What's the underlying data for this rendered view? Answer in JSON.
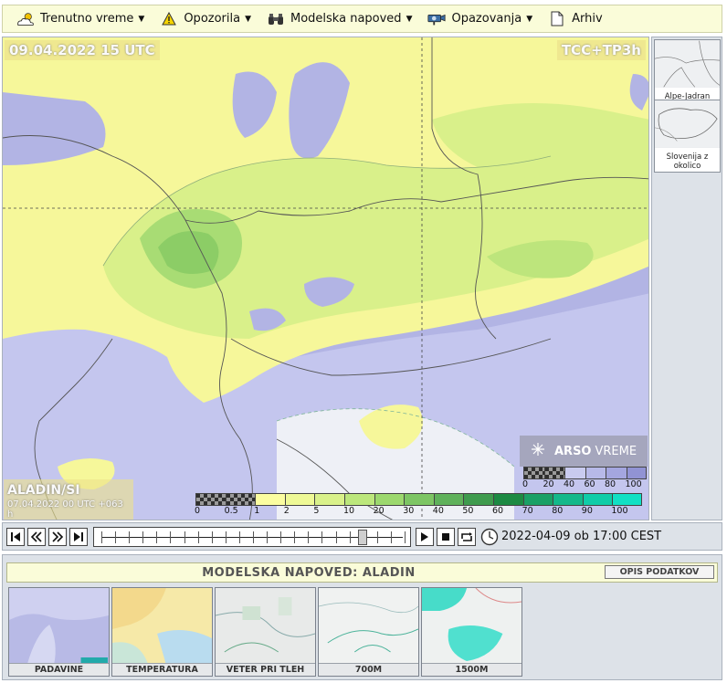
{
  "nav": {
    "items": [
      {
        "label": "Trenutno vreme",
        "icon": "weather-cloud-icon",
        "dropdown": true
      },
      {
        "label": "Opozorila",
        "icon": "warning-icon",
        "dropdown": true
      },
      {
        "label": "Modelska napoved",
        "icon": "binoculars-icon",
        "dropdown": true
      },
      {
        "label": "Opazovanja",
        "icon": "camera-icon",
        "dropdown": true
      },
      {
        "label": "Arhiv",
        "icon": "document-icon",
        "dropdown": false
      }
    ]
  },
  "map": {
    "datetime": "09.04.2022 15 UTC",
    "parameter": "TCC+TP3h",
    "model_name": "ALADIN/SI",
    "model_run": "07.04.2022 00 UTC +063 h",
    "brand_bold": "ARSO",
    "brand_light": "VREME",
    "cloud_legend": {
      "labels": [
        "0",
        "20",
        "40",
        "60",
        "80",
        "100"
      ],
      "colors": [
        "checker",
        "checker",
        "#c9cbef",
        "#b7b9e8",
        "#a4a6df",
        "#9193d4"
      ]
    },
    "precip_legend": {
      "labels": [
        "0",
        "0.5",
        "1",
        "2",
        "5",
        "10",
        "20",
        "30",
        "40",
        "50",
        "60",
        "70",
        "80",
        "90",
        "100"
      ],
      "colors": [
        "checker",
        "checker",
        "#fbfda0",
        "#eef996",
        "#d9f18a",
        "#bce77c",
        "#9cd86e",
        "#7dc564",
        "#5fb15b",
        "#3f9b4e",
        "#1d8a43",
        "#1aa066",
        "#14b88a",
        "#10cca8",
        "#12e0c4"
      ]
    }
  },
  "side_thumbs": [
    {
      "caption": "Alpe-Jadran"
    },
    {
      "caption": "Slovenija z okolico"
    }
  ],
  "player": {
    "timestamp": "2022-04-09 ob 17:00 CEST",
    "position_fraction": 0.86
  },
  "bottom": {
    "title": "MODELSKA NAPOVED: ALADIN",
    "button": "OPIS PODATKOV",
    "tiles": [
      {
        "label": "PADAVINE"
      },
      {
        "label": "TEMPERATURA"
      },
      {
        "label": "VETER PRI TLEH"
      },
      {
        "label": "700M"
      },
      {
        "label": "1500M"
      }
    ]
  }
}
